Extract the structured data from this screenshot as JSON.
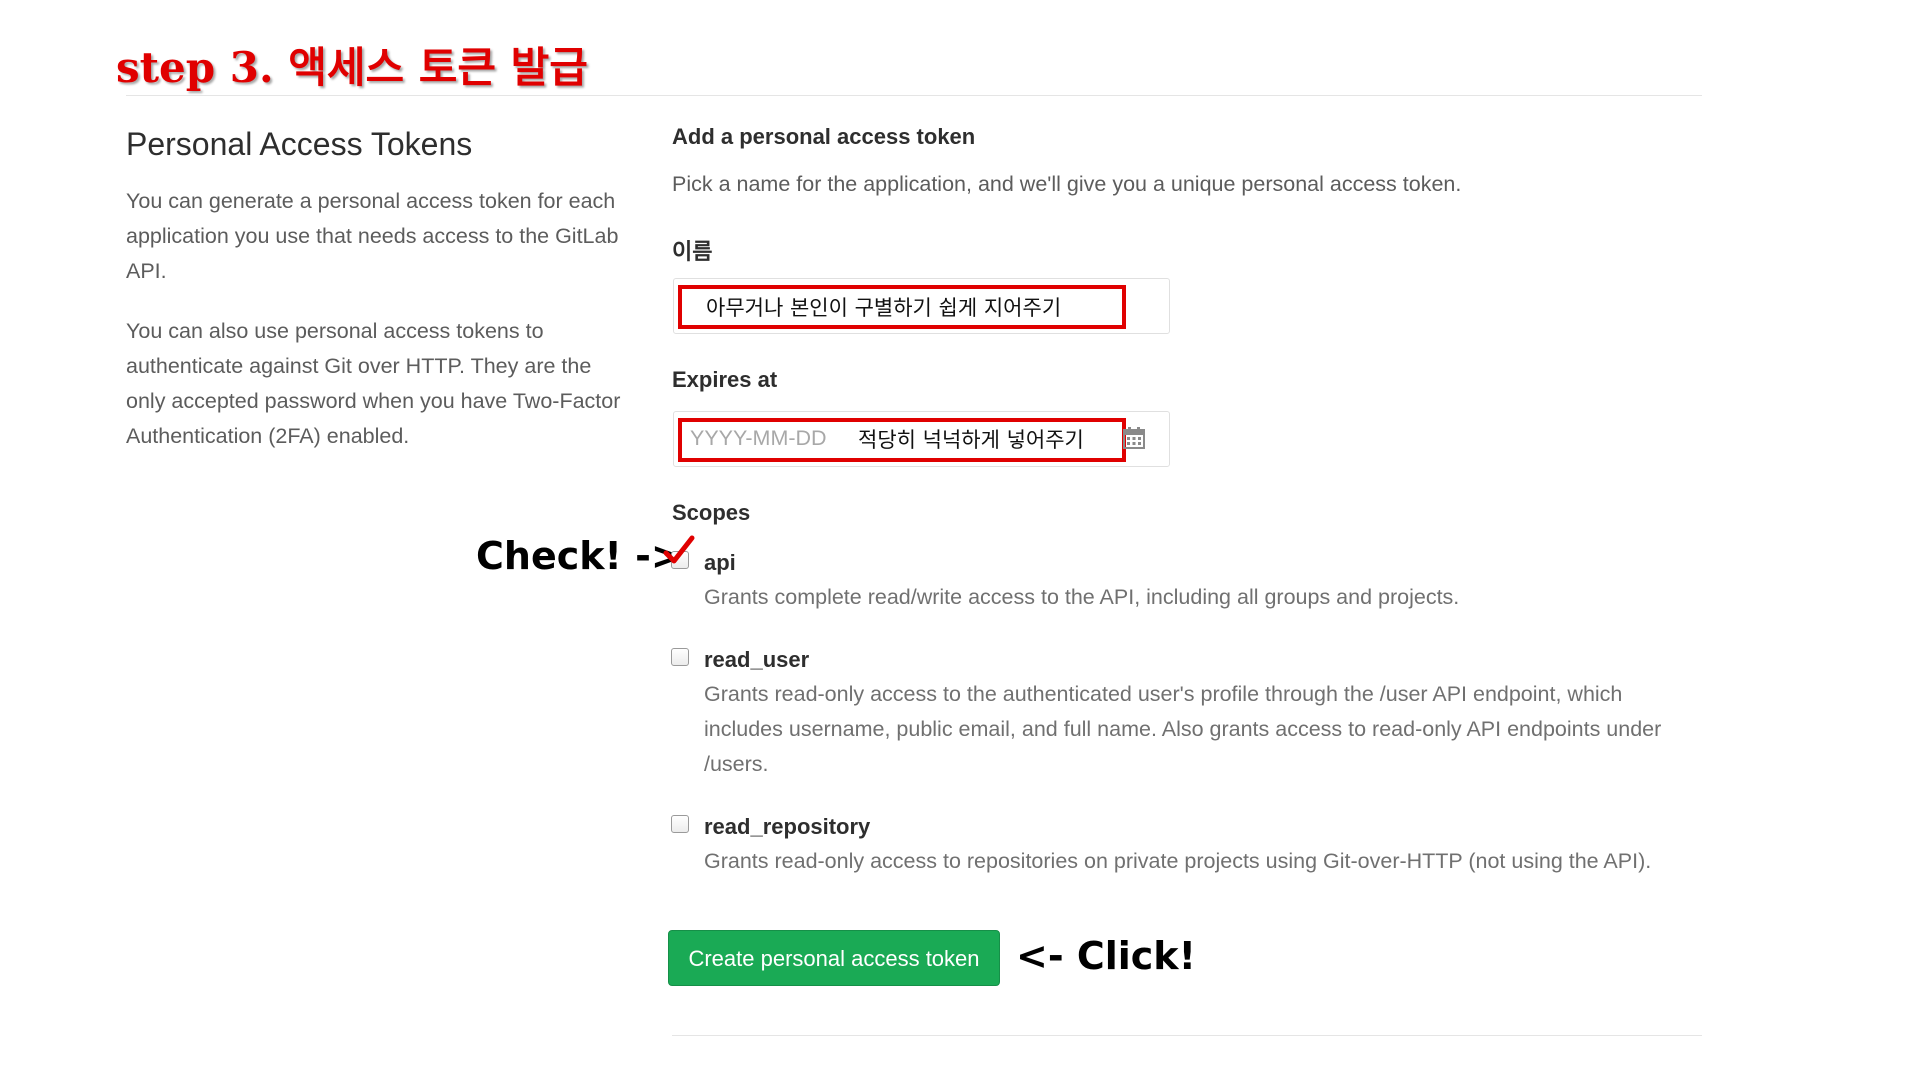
{
  "annotations": {
    "step_title": "step 3. 액세스 토큰 발급",
    "check_label": "Check! ->",
    "click_label": "<- Click!"
  },
  "left": {
    "heading": "Personal Access Tokens",
    "para1": "You can generate a personal access token for each application you use that needs access to the GitLab API.",
    "para2": "You can also use personal access tokens to authenticate against Git over HTTP. They are the only accepted password when you have Two-Factor Authentication (2FA) enabled."
  },
  "form": {
    "title": "Add a personal access token",
    "description": "Pick a name for the application, and we'll give you a unique personal access token.",
    "name_label": "이름",
    "name_value": "아무거나 본인이 구별하기 쉽게 지어주기",
    "expires_label": "Expires at",
    "expires_placeholder": "YYYY-MM-DD",
    "expires_note": "적당히 넉넉하게 넣어주기",
    "calendar_icon": "calendar-icon",
    "scopes_label": "Scopes",
    "scopes": [
      {
        "name": "api",
        "checked": true,
        "description": "Grants complete read/write access to the API, including all groups and projects."
      },
      {
        "name": "read_user",
        "checked": false,
        "description": "Grants read-only access to the authenticated user's profile through the /user API endpoint, which includes username, public email, and full name. Also grants access to read-only API endpoints under /users."
      },
      {
        "name": "read_repository",
        "checked": false,
        "description": "Grants read-only access to repositories on private projects using Git-over-HTTP (not using the API)."
      }
    ],
    "submit_label": "Create personal access token"
  },
  "colors": {
    "annotation_red": "#e00000",
    "button_green": "#1aaa55"
  }
}
